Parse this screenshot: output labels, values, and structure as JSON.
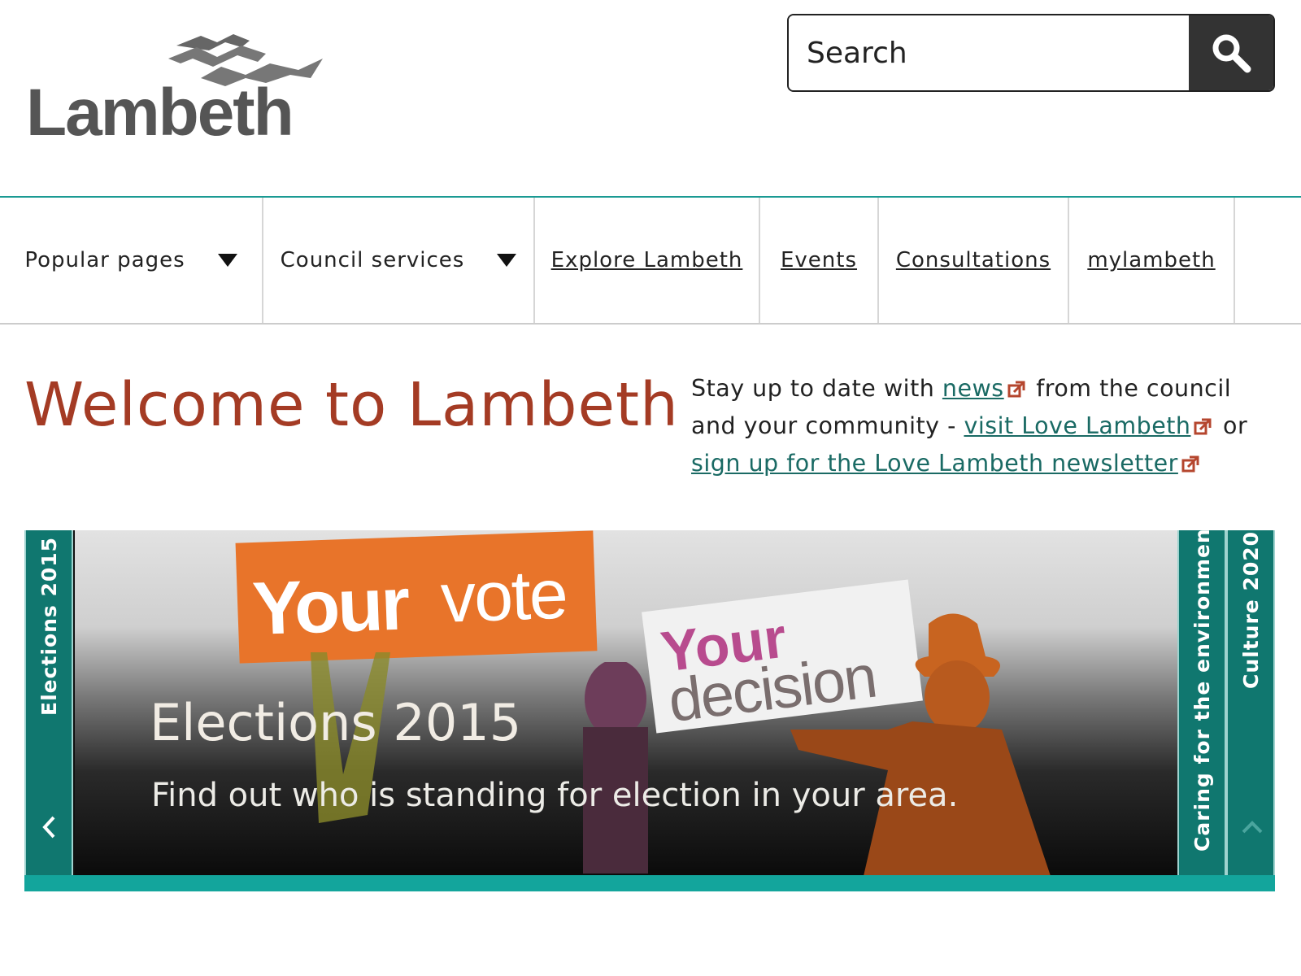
{
  "header": {
    "logo_text": "Lambeth",
    "search": {
      "placeholder": "Search",
      "button_icon": "search-icon"
    }
  },
  "nav": {
    "items": [
      {
        "label": "Popular pages",
        "dropdown": true
      },
      {
        "label": "Council services",
        "dropdown": true
      },
      {
        "label": "Explore Lambeth",
        "dropdown": false
      },
      {
        "label": "Events",
        "dropdown": false
      },
      {
        "label": "Consultations",
        "dropdown": false
      },
      {
        "label": "mylambeth",
        "dropdown": false
      }
    ]
  },
  "welcome": {
    "title": "Welcome to Lambeth",
    "intro": {
      "t1": "Stay up to date with ",
      "link_news": "news",
      "t2": " from the council and your community - ",
      "link_love": "visit Love Lambeth",
      "t3": " or ",
      "link_signup": "sign up for the Love Lambeth newsletter"
    }
  },
  "carousel": {
    "left_tab": "Elections 2015",
    "right_tabs": [
      "Caring for the environment",
      "Culture 2020"
    ],
    "slide": {
      "sign_orange_bold": "Your",
      "sign_orange_light": "vote",
      "sign_white_bold": "Your",
      "sign_white_light": "decision",
      "title": "Elections 2015",
      "description": "Find out who is standing for election in your area."
    },
    "colors": {
      "tab": "#10776f",
      "accent": "#13a59c",
      "title_red": "#a43b24"
    }
  }
}
